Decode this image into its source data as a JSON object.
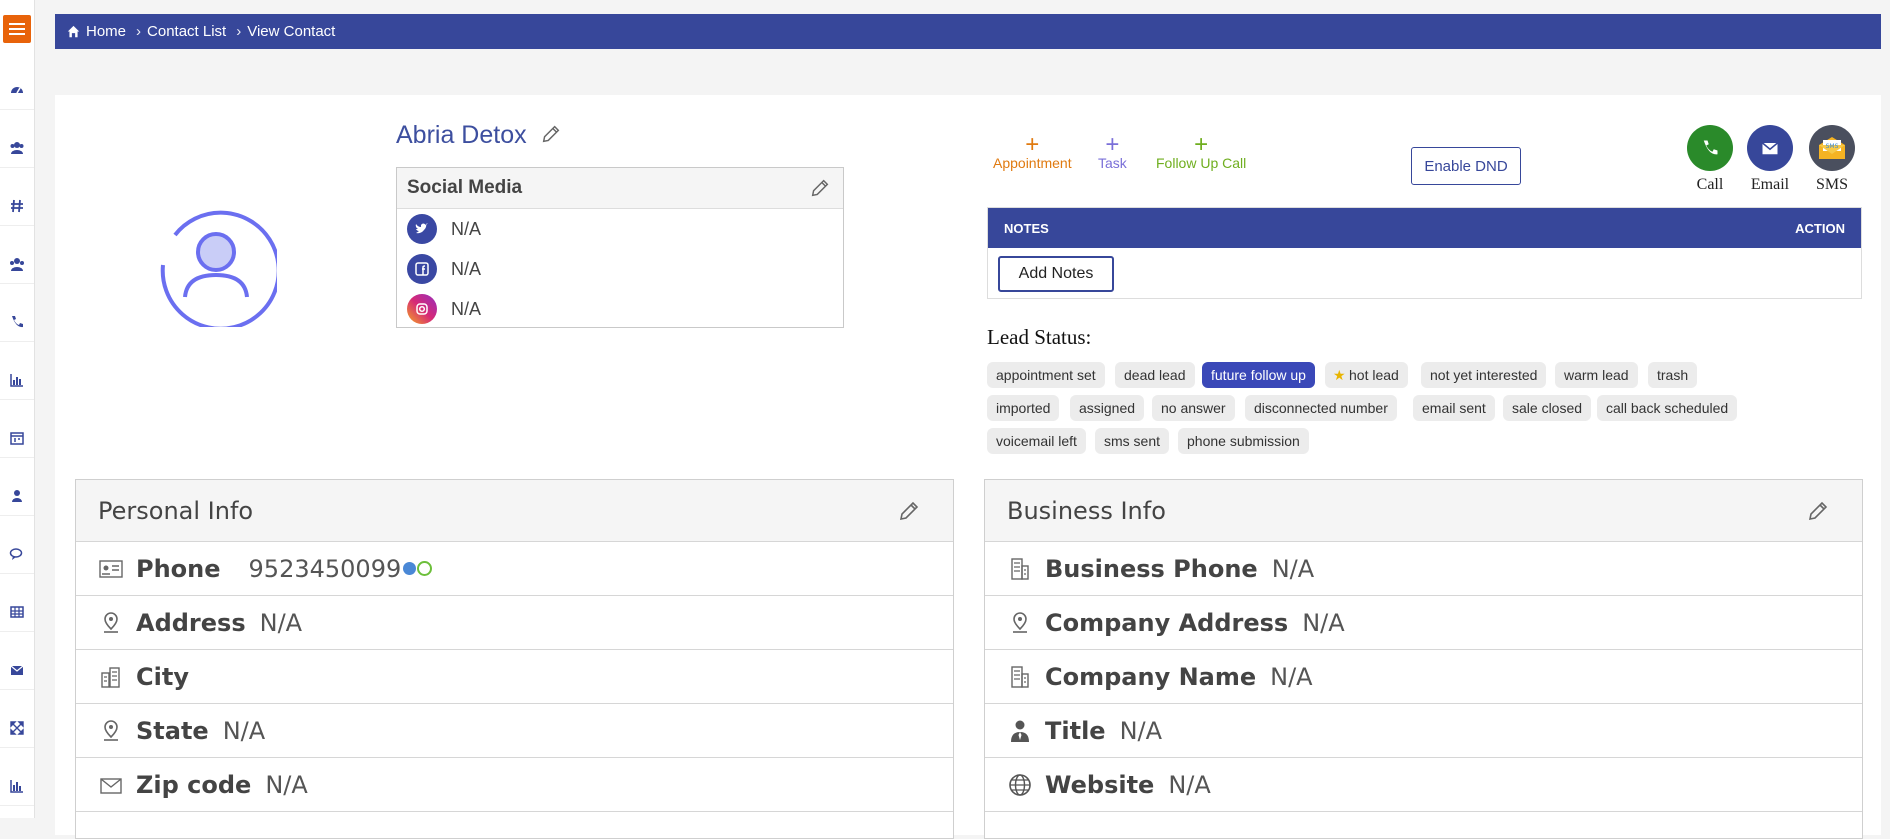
{
  "breadcrumb": {
    "home": "Home",
    "contact_list": "Contact List",
    "current": "View Contact"
  },
  "sidebar": {
    "items": [
      "dashboard-icon",
      "users-icon",
      "hashtag-icon",
      "group-icon",
      "phone-icon",
      "chart-icon",
      "calendar-icon",
      "agent-icon",
      "chat-icon",
      "table-icon",
      "envelope-icon",
      "expand-icon",
      "bar-chart-icon"
    ]
  },
  "contact": {
    "name": "Abria Detox"
  },
  "social_media": {
    "title": "Social Media",
    "twitter": "N/A",
    "facebook": "N/A",
    "instagram": "N/A"
  },
  "quick_actions": {
    "appointment": "Appointment",
    "task": "Task",
    "follow_up": "Follow Up Call"
  },
  "dnd_button": "Enable DND",
  "communication": {
    "call": "Call",
    "email": "Email",
    "sms": "SMS",
    "sms_badge": "SMS"
  },
  "notes": {
    "header": "NOTES",
    "action": "ACTION",
    "add_button": "Add Notes"
  },
  "lead_status": {
    "title": "Lead Status:",
    "chips": [
      "appointment set",
      "dead lead",
      "future follow up",
      "hot lead",
      "not yet interested",
      "warm lead",
      "trash",
      "imported",
      "assigned",
      "no answer",
      "disconnected number",
      "email sent",
      "sale closed",
      "call back scheduled",
      "voicemail left",
      "sms sent",
      "phone submission"
    ],
    "active": "future follow up"
  },
  "personal_info": {
    "title": "Personal Info",
    "phone_label": "Phone",
    "phone_value": "9523450099",
    "address_label": "Address",
    "address_value": "N/A",
    "city_label": "City",
    "city_value": "",
    "state_label": "State",
    "state_value": "N/A",
    "zip_label": "Zip code",
    "zip_value": "N/A"
  },
  "business_info": {
    "title": "Business Info",
    "phone_label": "Business Phone",
    "phone_value": "N/A",
    "address_label": "Company Address",
    "address_value": "N/A",
    "name_label": "Company Name",
    "name_value": "N/A",
    "title_label": "Title",
    "title_value": "N/A",
    "website_label": "Website",
    "website_value": "N/A"
  },
  "colors": {
    "primary": "#37479a",
    "accent_orange": "#e8630a",
    "chip_active": "#3a48b8",
    "call_green": "#2a8a2a"
  }
}
